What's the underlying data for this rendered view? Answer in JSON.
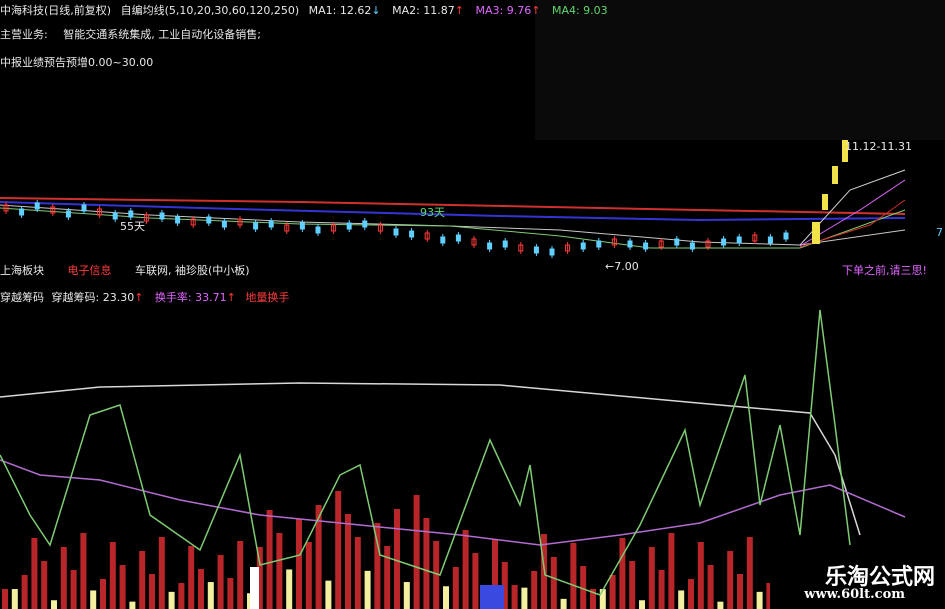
{
  "header": {
    "title": "中海科技(日线,前复权)",
    "ma_label": "自编均线(5,10,20,30,60,120,250)",
    "ma1": "MA1: 12.62",
    "ma2": "MA2: 11.87",
    "ma3": "MA3: 9.76",
    "ma4": "MA4: 9.03",
    "business_label": "主营业务:",
    "business_text": "智能交通系统集成, 工业自动化设备销售;",
    "forecast": "中报业绩预告预增0.00~30.00"
  },
  "price_panel": {
    "high_label": "11.12-11.31",
    "low_label": "7.00",
    "day93": "93天",
    "day55": "55天",
    "right_axis_digit": "7"
  },
  "info_row": {
    "sector": "上海板块",
    "industry": "电子信息",
    "concepts": "车联网, 袖珍股(中小板)",
    "warning": "下单之前,请三思!"
  },
  "indicator_header": {
    "name": "穿越筹码",
    "value": "穿越筹码: 23.30",
    "turnover": "换手率: 33.71",
    "ground_turnover": "地量换手"
  },
  "watermark": {
    "cn": "乐淘公式网",
    "url": "www.60lt.com"
  },
  "colors": {
    "background": "#000000",
    "up": "#ff3b3b",
    "down": "#5fd0ff",
    "yellow": "#f2e24a",
    "magenta": "#e066ff",
    "green_line": "#7ecb73"
  }
}
